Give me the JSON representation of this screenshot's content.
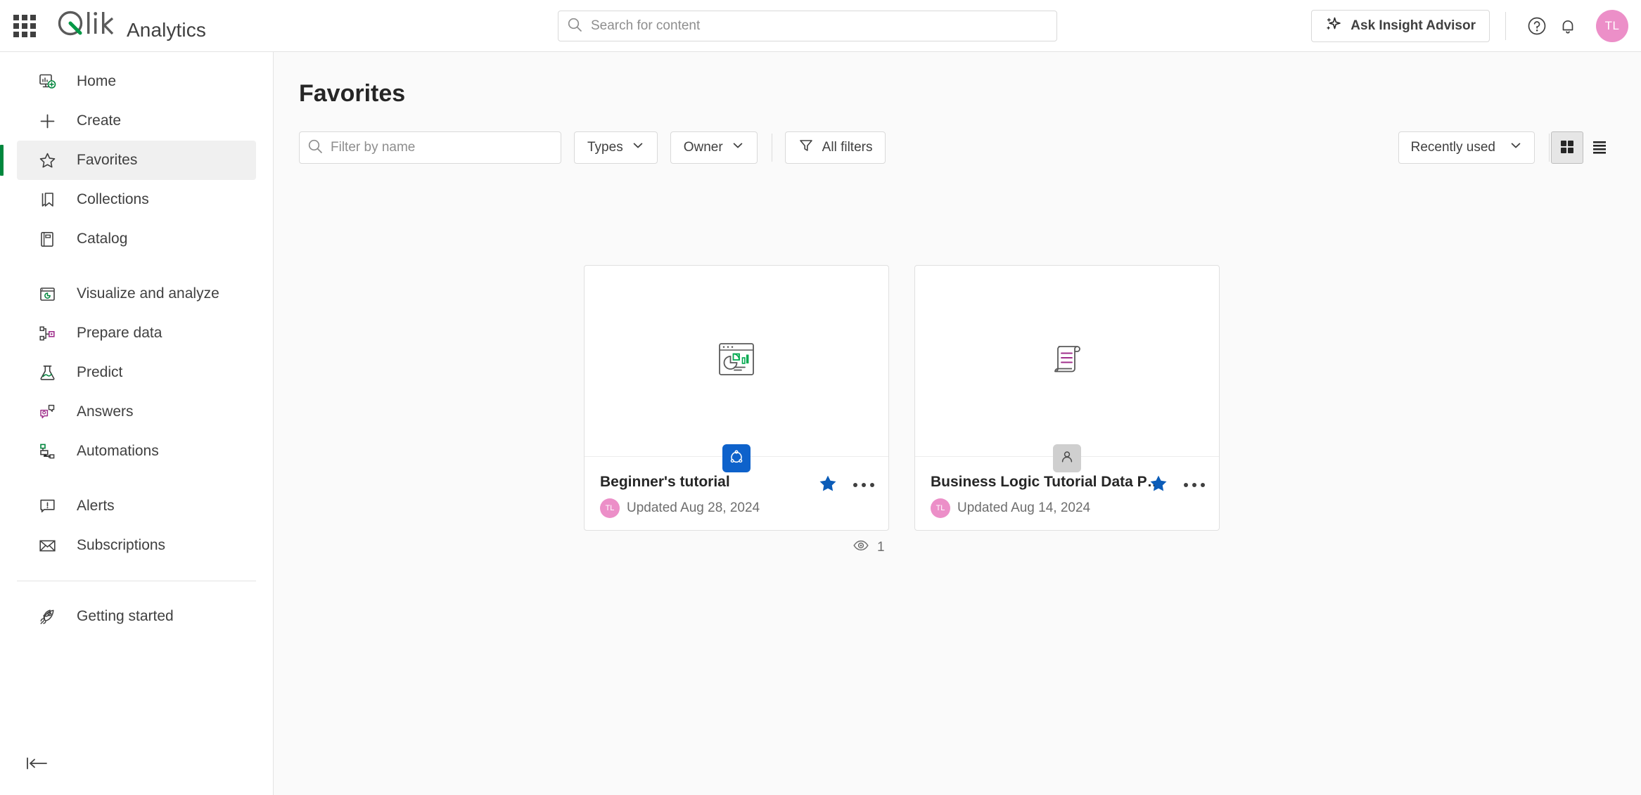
{
  "header": {
    "app_grid_icon": "waffle-grid-icon",
    "brand_logo": "qlik-logo",
    "brand_name": "Analytics",
    "search": {
      "placeholder": "Search for content",
      "value": "",
      "icon": "search-icon"
    },
    "ask_insight_advisor": {
      "label": "Ask Insight Advisor",
      "icon": "sparkle-icon"
    },
    "help_icon": "help-circle-icon",
    "notifications_icon": "bell-icon",
    "avatar": {
      "initials": "TL",
      "color": "#EC8FC8"
    }
  },
  "sidebar": {
    "items": [
      {
        "label": "Home",
        "icon": "home-dashboard-icon",
        "active": false
      },
      {
        "label": "Create",
        "icon": "plus-icon",
        "active": false
      },
      {
        "label": "Favorites",
        "icon": "star-outline-icon",
        "active": true
      },
      {
        "label": "Collections",
        "icon": "bookmark-icon",
        "active": false
      },
      {
        "label": "Catalog",
        "icon": "catalog-book-icon",
        "active": false
      },
      {
        "label": "Visualize and analyze",
        "icon": "chart-window-icon",
        "active": false
      },
      {
        "label": "Prepare data",
        "icon": "data-prep-icon",
        "active": false
      },
      {
        "label": "Predict",
        "icon": "flask-icon",
        "active": false
      },
      {
        "label": "Answers",
        "icon": "answers-chat-icon",
        "active": false
      },
      {
        "label": "Automations",
        "icon": "automations-flow-icon",
        "active": false
      },
      {
        "label": "Alerts",
        "icon": "alert-bubble-icon",
        "active": false
      },
      {
        "label": "Subscriptions",
        "icon": "envelope-icon",
        "active": false
      },
      {
        "label": "Getting started",
        "icon": "rocket-icon",
        "active": false
      }
    ],
    "collapse_icon": "collapse-left-icon",
    "active_accent_color": "#00873D"
  },
  "main": {
    "page_title": "Favorites",
    "toolbar": {
      "filter_input": {
        "placeholder": "Filter by name",
        "value": "",
        "icon": "search-icon"
      },
      "types_label": "Types",
      "owner_label": "Owner",
      "all_filters_label": "All filters",
      "all_filters_icon": "funnel-icon",
      "chevron_icon": "chevron-down-icon",
      "sort_label": "Recently used",
      "view_grid_icon": "grid-view-icon",
      "view_list_icon": "list-view-icon",
      "active_view": "grid"
    },
    "cards": [
      {
        "title": "Beginner's tutorial",
        "updated": "Updated Aug 28, 2024",
        "owner_initials": "TL",
        "thumb_icon": "app-chart-window-icon",
        "badge_icon": "qlik-sense-app-icon",
        "badge_style": "blue",
        "favorited": true,
        "star_icon": "star-filled-icon",
        "more_icon": "more-horizontal-icon"
      },
      {
        "title": "Business Logic Tutorial Data Prep",
        "updated": "Updated Aug 14, 2024",
        "owner_initials": "TL",
        "thumb_icon": "script-scroll-icon",
        "badge_icon": "person-icon",
        "badge_style": "grey",
        "favorited": true,
        "star_icon": "star-filled-icon",
        "more_icon": "more-horizontal-icon"
      }
    ],
    "view_count": {
      "icon": "eye-icon",
      "value": "1"
    }
  }
}
